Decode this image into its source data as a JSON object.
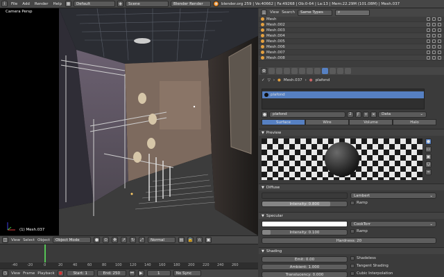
{
  "topbar": {
    "menus": [
      "File",
      "Add",
      "Render",
      "Help"
    ],
    "layout": "Default",
    "scene": "Scene",
    "engine": "Blender Render",
    "info": "blender.org 259 | Ve:40662 | Fa:49268 | Ob:0-64 | La:13 | Mem:22.29M (101.08M) | Mesh.037"
  },
  "viewport": {
    "label": "Camera Persp",
    "object_label": "(1) Mesh.037"
  },
  "vp_header": {
    "view": "View",
    "select": "Select",
    "object": "Object",
    "mode": "Object Mode",
    "pivot": "Normal"
  },
  "timeline": {
    "ticks": [
      "-40",
      "-20",
      "0",
      "20",
      "40",
      "60",
      "80",
      "100",
      "120",
      "140",
      "160",
      "180",
      "200",
      "220",
      "240",
      "260"
    ],
    "footer": {
      "view": "View",
      "frame": "Frame",
      "playback": "Playback",
      "start": "Start: 1",
      "end": "End: 250",
      "current": "1",
      "sync": "No Sync"
    }
  },
  "outliner": {
    "view": "View",
    "search": "Search",
    "filter": "Same Types",
    "items": [
      "Mesh",
      "Mesh.002",
      "Mesh.003",
      "Mesh.004",
      "Mesh.005",
      "Mesh.006",
      "Mesh.007",
      "Mesh.008"
    ]
  },
  "props": {
    "breadcrumb_obj": "Mesh.037",
    "breadcrumb_mat": "plafond",
    "slot": "plafond",
    "material_name": "plafond",
    "material_users": "2",
    "data_link": "Data",
    "render_tabs": [
      "Surface",
      "Wire",
      "Volume",
      "Halo"
    ],
    "preview": "Preview",
    "diffuse": {
      "title": "Diffuse",
      "shader": "Lambert",
      "intensity": "Intensity: 0.800",
      "ramp": "Ramp"
    },
    "specular": {
      "title": "Specular",
      "shader": "CookTorr",
      "intensity": "Intensity: 0.100",
      "ramp": "Ramp",
      "hardness": "Hardness: 20"
    },
    "shading": {
      "title": "Shading",
      "emit": "Emit: 0.00",
      "ambient": "Ambient: 1.000",
      "translucency": "Translucency: 0.000",
      "shadeless": "Shadeless",
      "tangent": "Tangent Shading",
      "cubic": "Cubic Interpolation"
    }
  }
}
